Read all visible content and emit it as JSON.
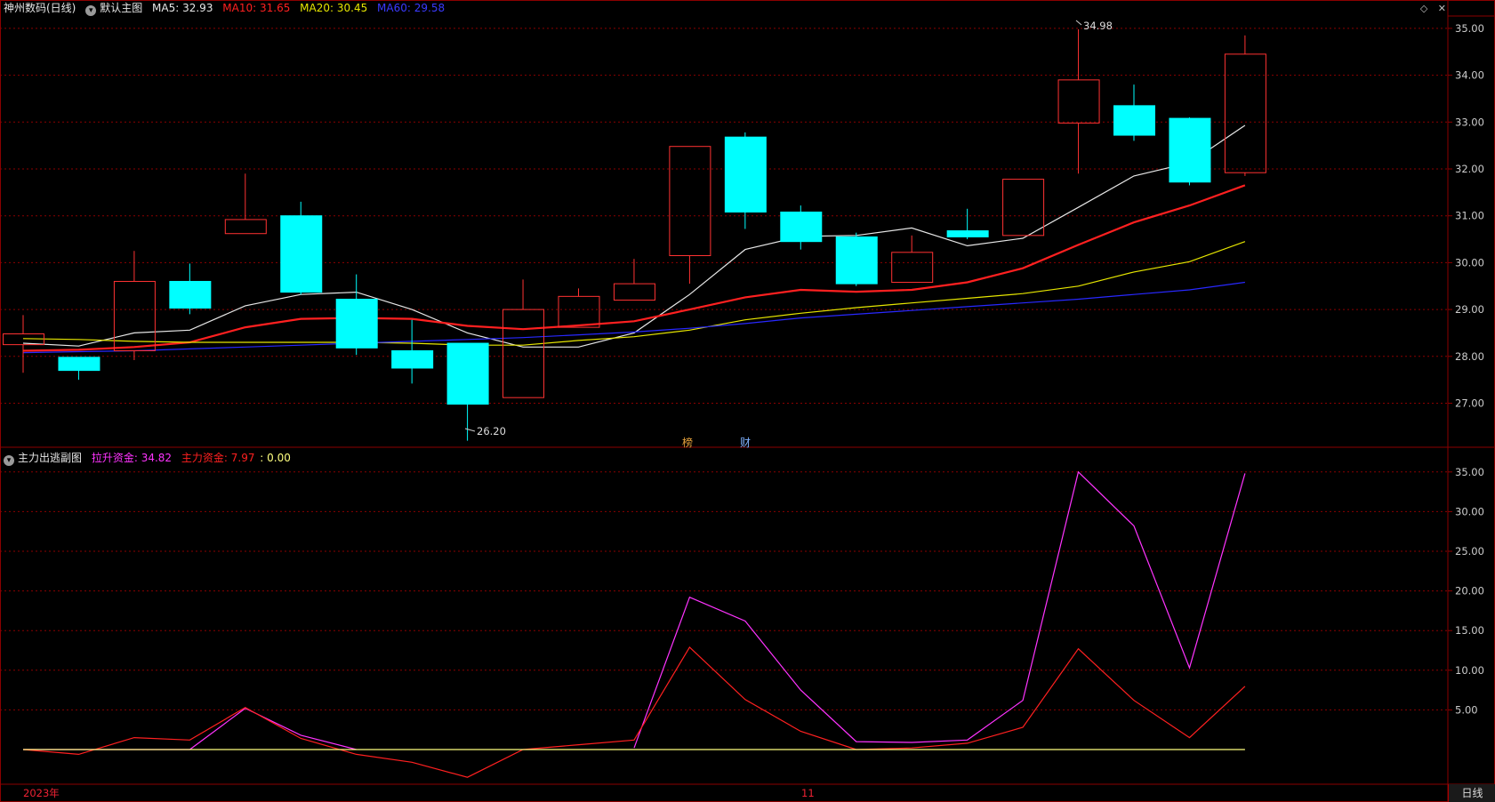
{
  "main_header": {
    "stock": "神州数码(日线)",
    "template_icon": "chevron-down-icon",
    "template": "默认主图",
    "ma5": "MA5: 32.93",
    "ma10": "MA10: 31.65",
    "ma20": "MA20: 30.45",
    "ma60": "MA60: 29.58"
  },
  "sub_header": {
    "name": "主力出逃副图",
    "lashing": "拉升资金: 34.82",
    "main_fund": "主力资金: 7.97",
    "zero": ": 0.00"
  },
  "window_icons": [
    "diamond-icon",
    "close-icon"
  ],
  "annotations": {
    "high": "34.98",
    "low": "26.20",
    "mark1": "榜",
    "mark2": "财"
  },
  "bottom_axis": {
    "year": "2023年",
    "month": "11"
  },
  "period_button": "日线",
  "colors": {
    "bull": "#ff3232",
    "bear": "#00ffff",
    "ma5": "#e6e6e6",
    "ma10": "#ff2020",
    "ma20": "#e6e600",
    "ma60": "#2828ff",
    "lashing": "#ff33ff",
    "main_fund": "#ff2020",
    "zero_line": "#ffff80",
    "grid": "#8b0000",
    "axis_text": "#cccccc"
  },
  "chart_data": [
    {
      "type": "candlestick",
      "price_axis_ticks": [
        "27.00",
        "28.00",
        "29.00",
        "30.00",
        "31.00",
        "32.00",
        "33.00",
        "34.00",
        "35.00"
      ],
      "ylim": [
        26.0,
        35.2
      ],
      "candles": [
        {
          "o": 28.25,
          "h": 28.88,
          "l": 27.65,
          "c": 28.48
        },
        {
          "o": 27.98,
          "h": 27.98,
          "l": 27.5,
          "c": 27.7
        },
        {
          "o": 28.12,
          "h": 30.25,
          "l": 27.92,
          "c": 29.6
        },
        {
          "o": 29.6,
          "h": 29.98,
          "l": 28.9,
          "c": 29.03
        },
        {
          "o": 30.62,
          "h": 31.9,
          "l": 30.62,
          "c": 30.92
        },
        {
          "o": 31.0,
          "h": 31.3,
          "l": 29.32,
          "c": 29.37
        },
        {
          "o": 29.22,
          "h": 29.75,
          "l": 28.03,
          "c": 28.18
        },
        {
          "o": 28.12,
          "h": 28.78,
          "l": 27.42,
          "c": 27.75
        },
        {
          "o": 28.28,
          "h": 28.28,
          "l": 26.2,
          "c": 26.98
        },
        {
          "o": 27.12,
          "h": 29.64,
          "l": 27.12,
          "c": 29.0
        },
        {
          "o": 28.62,
          "h": 29.45,
          "l": 28.62,
          "c": 29.28
        },
        {
          "o": 29.2,
          "h": 30.08,
          "l": 29.2,
          "c": 29.55
        },
        {
          "o": 30.15,
          "h": 32.48,
          "l": 29.55,
          "c": 32.48
        },
        {
          "o": 32.68,
          "h": 32.78,
          "l": 30.72,
          "c": 31.08
        },
        {
          "o": 31.08,
          "h": 31.22,
          "l": 30.28,
          "c": 30.45
        },
        {
          "o": 30.55,
          "h": 30.64,
          "l": 29.5,
          "c": 29.55
        },
        {
          "o": 29.58,
          "h": 30.58,
          "l": 29.58,
          "c": 30.22
        },
        {
          "o": 30.68,
          "h": 31.15,
          "l": 30.5,
          "c": 30.55
        },
        {
          "o": 30.58,
          "h": 31.78,
          "l": 30.58,
          "c": 31.78
        },
        {
          "o": 32.98,
          "h": 34.98,
          "l": 31.9,
          "c": 33.9
        },
        {
          "o": 33.35,
          "h": 33.8,
          "l": 32.6,
          "c": 32.72
        },
        {
          "o": 33.08,
          "h": 33.1,
          "l": 31.65,
          "c": 31.72
        },
        {
          "o": 31.92,
          "h": 34.85,
          "l": 31.85,
          "c": 34.45
        }
      ],
      "series": [
        {
          "name": "MA5",
          "values": [
            28.28,
            28.22,
            28.5,
            28.56,
            29.08,
            29.32,
            29.37,
            29.0,
            28.5,
            28.2,
            28.2,
            28.5,
            29.32,
            30.28,
            30.56,
            30.58,
            30.74,
            30.36,
            30.52,
            31.18,
            31.85,
            32.13,
            32.93
          ]
        },
        {
          "name": "MA10",
          "values": [
            28.12,
            28.14,
            28.2,
            28.3,
            28.62,
            28.8,
            28.82,
            28.8,
            28.65,
            28.58,
            28.66,
            28.75,
            29.0,
            29.26,
            29.42,
            29.38,
            29.42,
            29.58,
            29.88,
            30.38,
            30.86,
            31.22,
            31.65
          ]
        },
        {
          "name": "MA20",
          "values": [
            28.38,
            28.36,
            28.32,
            28.3,
            28.3,
            28.3,
            28.3,
            28.28,
            28.24,
            28.24,
            28.34,
            28.42,
            28.56,
            28.78,
            28.92,
            29.04,
            29.14,
            29.24,
            29.34,
            29.5,
            29.8,
            30.02,
            30.45
          ]
        },
        {
          "name": "MA60",
          "values": [
            28.08,
            28.1,
            28.12,
            28.16,
            28.2,
            28.24,
            28.28,
            28.32,
            28.36,
            28.4,
            28.46,
            28.52,
            28.6,
            28.7,
            28.82,
            28.9,
            28.98,
            29.06,
            29.14,
            29.22,
            29.32,
            29.42,
            29.58
          ]
        }
      ]
    },
    {
      "type": "line",
      "y_axis_ticks": [
        "5.00",
        "10.00",
        "15.00",
        "20.00",
        "25.00",
        "30.00",
        "35.00"
      ],
      "ylim": [
        -4.5,
        36.0
      ],
      "series": [
        {
          "name": "拉升资金",
          "values": [
            0,
            0,
            0,
            0,
            5.2,
            1.8,
            0,
            null,
            null,
            null,
            null,
            0.2,
            19.2,
            16.2,
            7.5,
            1,
            0.9,
            1.2,
            6.2,
            35,
            28.2,
            10.3,
            34.82
          ]
        },
        {
          "name": "主力资金",
          "values": [
            0,
            -0.6,
            1.5,
            1.2,
            5.3,
            1.4,
            -0.6,
            -1.6,
            -3.5,
            0,
            0.6,
            1.2,
            12.9,
            6.3,
            2.3,
            0,
            0.2,
            0.8,
            2.8,
            12.7,
            6.2,
            1.5,
            7.97
          ]
        },
        {
          "name": "",
          "values": [
            0,
            0,
            0,
            0,
            0,
            0,
            0,
            0,
            0,
            0,
            0,
            0,
            0,
            0,
            0,
            0,
            0,
            0,
            0,
            0,
            0,
            0,
            0
          ]
        }
      ]
    }
  ]
}
